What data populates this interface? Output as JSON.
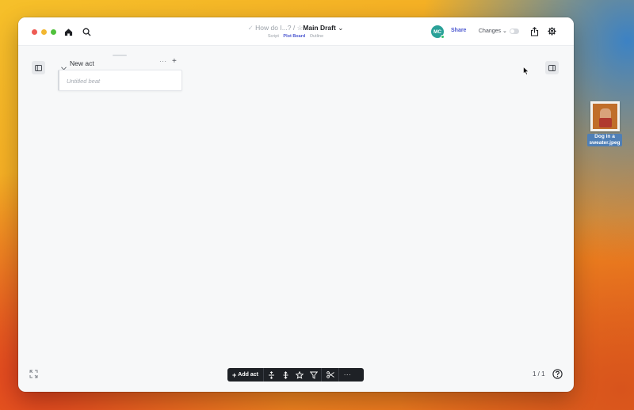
{
  "window": {
    "breadcrumb": "How do I...?",
    "separator": "/",
    "draft_title": "Main Draft",
    "modes": [
      "Script",
      "Plot Board",
      "Outline"
    ],
    "active_mode": "Plot Board",
    "avatar_initials": "MC",
    "share_label": "Share",
    "changes_label": "Changes"
  },
  "board": {
    "act_title": "New act",
    "beat_placeholder": "Untitled beat"
  },
  "toolbar": {
    "add_act_label": "Add act",
    "icons": [
      "split-vertical-icon",
      "move-vertical-icon",
      "star-icon",
      "filter-icon",
      "scissors-icon",
      "more-icon"
    ]
  },
  "footer": {
    "page_count": "1 / 1"
  },
  "desktop": {
    "file_name_line1": "Dog in a",
    "file_name_line2": "sweater.jpeg"
  },
  "colors": {
    "accent": "#4b57d0",
    "avatar": "#2aa198",
    "toolbar_bg": "#1e2126"
  }
}
